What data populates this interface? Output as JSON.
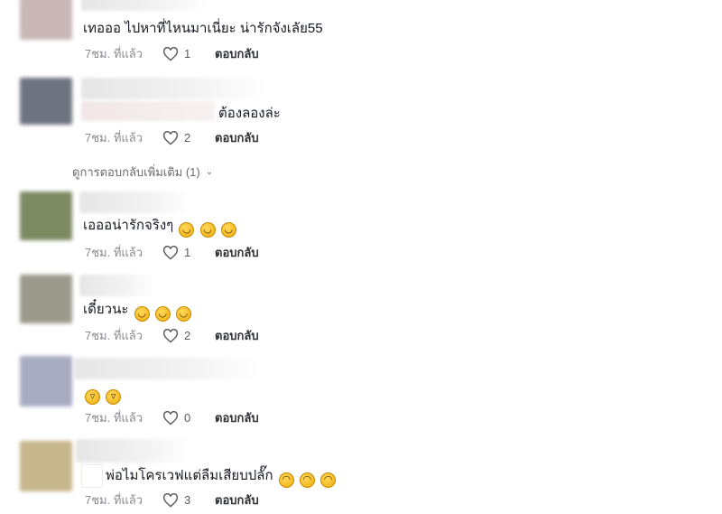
{
  "comments": [
    {
      "text": "เทอออ ไปหาที่ไหนมาเนี่ยะ น่ารักจังเลัย55",
      "time": "7ชม. ที่แล้ว",
      "likes": "1",
      "reply": "ตอบกลับ",
      "avatar_color": "#c9b7b5",
      "emojis": []
    },
    {
      "text": "ต้องลองล่ะ",
      "time": "7ชม. ที่แล้ว",
      "likes": "2",
      "reply": "ตอบกลับ",
      "avatar_color": "#6d7480",
      "emojis": []
    },
    {
      "text": "เอออน่ารักจริงๆ",
      "time": "7ชม. ที่แล้ว",
      "likes": "1",
      "reply": "ตอบกลับ",
      "avatar_color": "#7c8b62",
      "emojis": [
        "😂",
        "😂",
        "😂"
      ]
    },
    {
      "text": "เดี๋ยวนะ",
      "time": "7ชม. ที่แล้ว",
      "likes": "2",
      "reply": "ตอบกลับ",
      "avatar_color": "#9b9a8c",
      "emojis": [
        "😂",
        "😂",
        "😂"
      ]
    },
    {
      "text": "",
      "time": "7ชม. ที่แล้ว",
      "likes": "0",
      "reply": "ตอบกลับ",
      "avatar_color": "#a7acc2",
      "emojis": [
        "😁",
        "😁"
      ]
    },
    {
      "text": "พ่อไมโครเวฟแต่ลืมเสียบปลั๊ก",
      "time": "7ชม. ที่แล้ว",
      "likes": "3",
      "reply": "ตอบกลับ",
      "avatar_color": "#c8b68c",
      "emojis": [
        "🤣",
        "🤣",
        "🤣"
      ]
    }
  ],
  "more_replies": "ดูการตอบกลับเพิ่มเติม (1)",
  "more_icon": "chevron-down-icon",
  "like_icon": "heart-outline-icon"
}
